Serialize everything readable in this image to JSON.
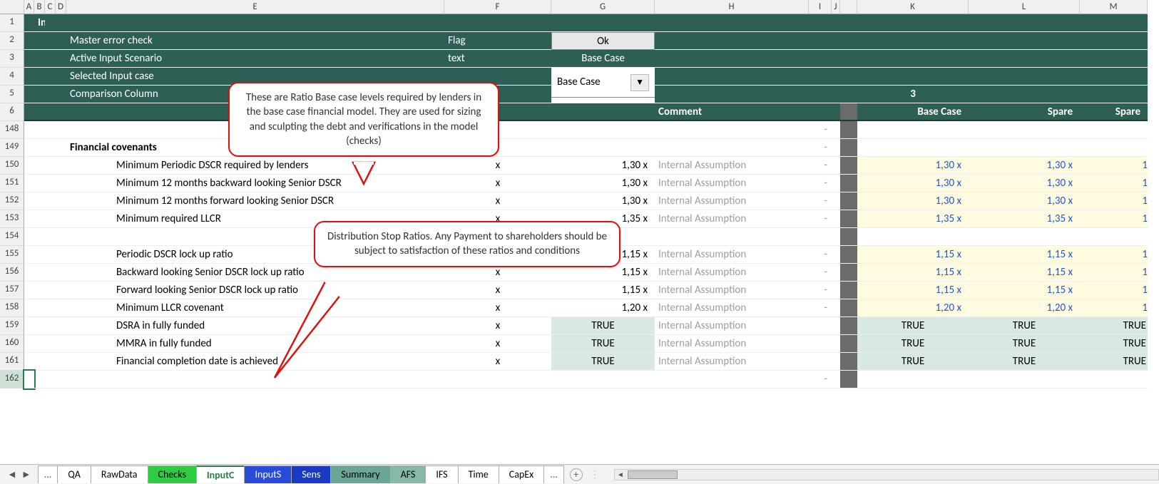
{
  "cols": [
    "",
    "A",
    "B",
    "C",
    "D",
    "E",
    "F",
    "G",
    "H",
    "I",
    "J",
    "",
    "K",
    "L",
    "M"
  ],
  "header": {
    "title": "InputC",
    "rows": {
      "master_error": "Master error check",
      "active_scenario": "Active Input Scenario",
      "selected_case": "Selected Input case",
      "comparison": "Comparison Column"
    },
    "f": {
      "flag": "Flag",
      "text": "text"
    },
    "g": {
      "ok": "Ok",
      "basecase": "Base Case",
      "dropdown": "Base Case"
    },
    "k": {
      "num": "3"
    },
    "row6": {
      "h": "Comment",
      "k": "Base Case",
      "l": "Spare",
      "m": "Spare"
    }
  },
  "row_numbers_top": [
    "1",
    "2",
    "3",
    "4",
    "5",
    "6"
  ],
  "section_title": "Financial covenants",
  "body_rows": [
    {
      "n": "148",
      "e": "",
      "f": "",
      "g": "",
      "h": "",
      "i": "-",
      "k": "",
      "l": "",
      "m": "",
      "yellow": false,
      "gtrue": false
    },
    {
      "n": "149",
      "e": "Financial covenants",
      "f": "",
      "g": "",
      "h": "",
      "i": "-",
      "k": "",
      "l": "",
      "m": "",
      "yellow": false,
      "gtrue": false,
      "bold": true
    },
    {
      "n": "150",
      "e": "Minimum Periodic DSCR required by lenders",
      "f": "x",
      "g": "1,30 x",
      "h": "Internal Assumption",
      "i": "-",
      "k": "1,30 x",
      "l": "1,30 x",
      "m": "1",
      "yellow": true,
      "gtrue": false
    },
    {
      "n": "151",
      "e": "Minimum 12 months backward looking Senior DSCR",
      "f": "x",
      "g": "1,30 x",
      "h": "Internal Assumption",
      "i": "-",
      "k": "1,30 x",
      "l": "1,30 x",
      "m": "1",
      "yellow": true,
      "gtrue": false
    },
    {
      "n": "152",
      "e": "Minimum 12 months forward looking Senior DSCR",
      "f": "x",
      "g": "1,30 x",
      "h": "Internal Assumption",
      "i": "-",
      "k": "1,30 x",
      "l": "1,30 x",
      "m": "1",
      "yellow": true,
      "gtrue": false
    },
    {
      "n": "153",
      "e": "Minimum required LLCR",
      "f": "x",
      "g": "1,35 x",
      "h": "Internal Assumption",
      "i": "-",
      "k": "1,35 x",
      "l": "1,35 x",
      "m": "1",
      "yellow": true,
      "gtrue": false
    },
    {
      "n": "154",
      "e": "",
      "f": "",
      "g": "",
      "h": "",
      "i": "",
      "k": "",
      "l": "",
      "m": "",
      "yellow": false,
      "gtrue": false
    },
    {
      "n": "155",
      "e": "Periodic DSCR lock up ratio",
      "f": "x",
      "g": "1,15 x",
      "h": "Internal Assumption",
      "i": "-",
      "k": "1,15 x",
      "l": "1,15 x",
      "m": "1",
      "yellow": true,
      "gtrue": false
    },
    {
      "n": "156",
      "e": "Backward looking Senior DSCR lock up ratio",
      "f": "x",
      "g": "1,15 x",
      "h": "Internal Assumption",
      "i": "-",
      "k": "1,15 x",
      "l": "1,15 x",
      "m": "1",
      "yellow": true,
      "gtrue": false
    },
    {
      "n": "157",
      "e": "Forward looking Senior DSCR lock up ratio",
      "f": "x",
      "g": "1,15 x",
      "h": "Internal Assumption",
      "i": "-",
      "k": "1,15 x",
      "l": "1,15 x",
      "m": "1",
      "yellow": true,
      "gtrue": false
    },
    {
      "n": "158",
      "e": "Minimum LLCR covenant",
      "f": "x",
      "g": "1,20 x",
      "h": "Internal Assumption",
      "i": "-",
      "k": "1,20 x",
      "l": "1,20 x",
      "m": "1",
      "yellow": true,
      "gtrue": false
    },
    {
      "n": "159",
      "e": "DSRA in fully funded",
      "f": "x",
      "g": "TRUE",
      "h": "Internal Assumption",
      "i": "",
      "k": "TRUE",
      "l": "TRUE",
      "m": "TRUE",
      "yellow": false,
      "gtrue": true
    },
    {
      "n": "160",
      "e": "MMRA in fully funded",
      "f": "x",
      "g": "TRUE",
      "h": "Internal Assumption",
      "i": "",
      "k": "TRUE",
      "l": "TRUE",
      "m": "TRUE",
      "yellow": false,
      "gtrue": true
    },
    {
      "n": "161",
      "e": "Financial completion date is achieved",
      "f": "x",
      "g": "TRUE",
      "h": "Internal Assumption",
      "i": "",
      "k": "TRUE",
      "l": "TRUE",
      "m": "TRUE",
      "yellow": false,
      "gtrue": true
    },
    {
      "n": "162",
      "e": "",
      "f": "",
      "g": "",
      "h": "",
      "i": "-",
      "k": "",
      "l": "",
      "m": "",
      "yellow": false,
      "gtrue": false,
      "selected": true
    }
  ],
  "callouts": {
    "c1": "These are Ratio  Base case levels required by lenders in the base case financial model. They are used for sizing and sculpting the debt and verifications in the model (checks)",
    "c2": "Distribution Stop Ratios. Any Payment to shareholders should be subject to satisfaction of these ratios and conditions"
  },
  "tabs": {
    "ellipsis_left": "...",
    "items": [
      {
        "label": "QA",
        "cls": ""
      },
      {
        "label": "RawData",
        "cls": ""
      },
      {
        "label": "Checks",
        "cls": "green"
      },
      {
        "label": "InputC",
        "cls": "active"
      },
      {
        "label": "InputS",
        "cls": "blue"
      },
      {
        "label": "Sens",
        "cls": "blue2"
      },
      {
        "label": "Summary",
        "cls": "teal"
      },
      {
        "label": "AFS",
        "cls": "teal2"
      },
      {
        "label": "IFS",
        "cls": ""
      },
      {
        "label": "Time",
        "cls": ""
      },
      {
        "label": "CapEx",
        "cls": ""
      }
    ],
    "ellipsis_right": "..."
  }
}
